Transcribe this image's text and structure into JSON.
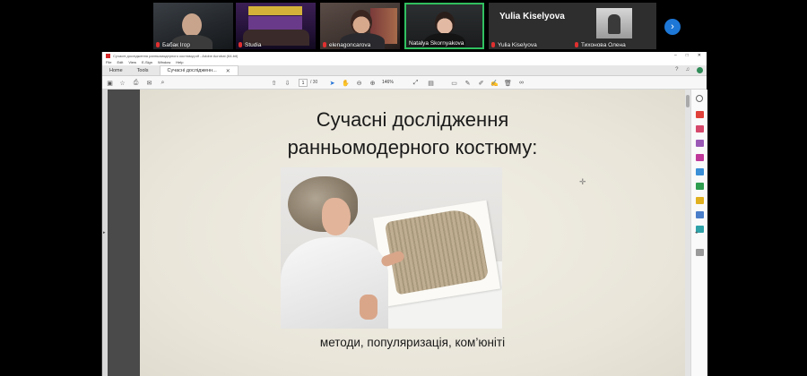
{
  "participants": [
    {
      "id": "p1",
      "name": "Бабак Ігор"
    },
    {
      "id": "p2",
      "name": "Studia"
    },
    {
      "id": "p3",
      "name": "elenagoncarova"
    },
    {
      "id": "p4",
      "name": "Natalya Skornyakova",
      "active": true
    },
    {
      "id": "p5",
      "name": "Yulia Kiselyova",
      "tile_title": "Yulia Kiselyova"
    },
    {
      "id": "p6",
      "name": "Тихонова Олена"
    }
  ],
  "strip": {
    "next_icon": "›"
  },
  "colors": {
    "active_speaker": "#30c060",
    "muted_mic": "#e03030",
    "acrobat_red": "#d42a2a",
    "accent": "#1d6ed6"
  },
  "window": {
    "title": "Сучасні дослідження ранньомодерного костюму.pdf - Adobe Acrobat (64-bit)",
    "controls": [
      "–",
      "□",
      "✕"
    ],
    "menu": [
      "File",
      "Edit",
      "View",
      "E-Sign",
      "Window",
      "Help"
    ],
    "tabs": {
      "home": "Home",
      "tools": "Tools",
      "document": "Сучасні дослідженн...",
      "close": "✕"
    },
    "toolbar": {
      "page_current": "1",
      "page_total": "/ 30",
      "zoom": "146%"
    }
  },
  "slide": {
    "title": "Сучасні дослідження ранньомодерного костюму:",
    "caption": "методи, популяризація, ком’юніті"
  },
  "icons": {
    "toolbar": [
      "save-icon",
      "star-icon",
      "print-icon",
      "mail-icon",
      "search-icon",
      "upload-icon",
      "download-icon",
      "select-cursor-icon",
      "hand-icon",
      "zoom-out-icon",
      "zoom-in-icon",
      "fit-page-icon",
      "scroll-mode-icon",
      "comment-icon",
      "pen-icon",
      "highlight-icon",
      "sign-icon",
      "delete-icon",
      "link-icon"
    ],
    "rail": [
      "zoom-icon",
      "export-pdf-icon",
      "create-pdf-icon",
      "comment-icon",
      "combine-files-icon",
      "edit-pdf-icon",
      "organize-pages-icon",
      "send-icon",
      "protect-icon",
      "fill-sign-icon",
      "more-tools-icon"
    ]
  }
}
